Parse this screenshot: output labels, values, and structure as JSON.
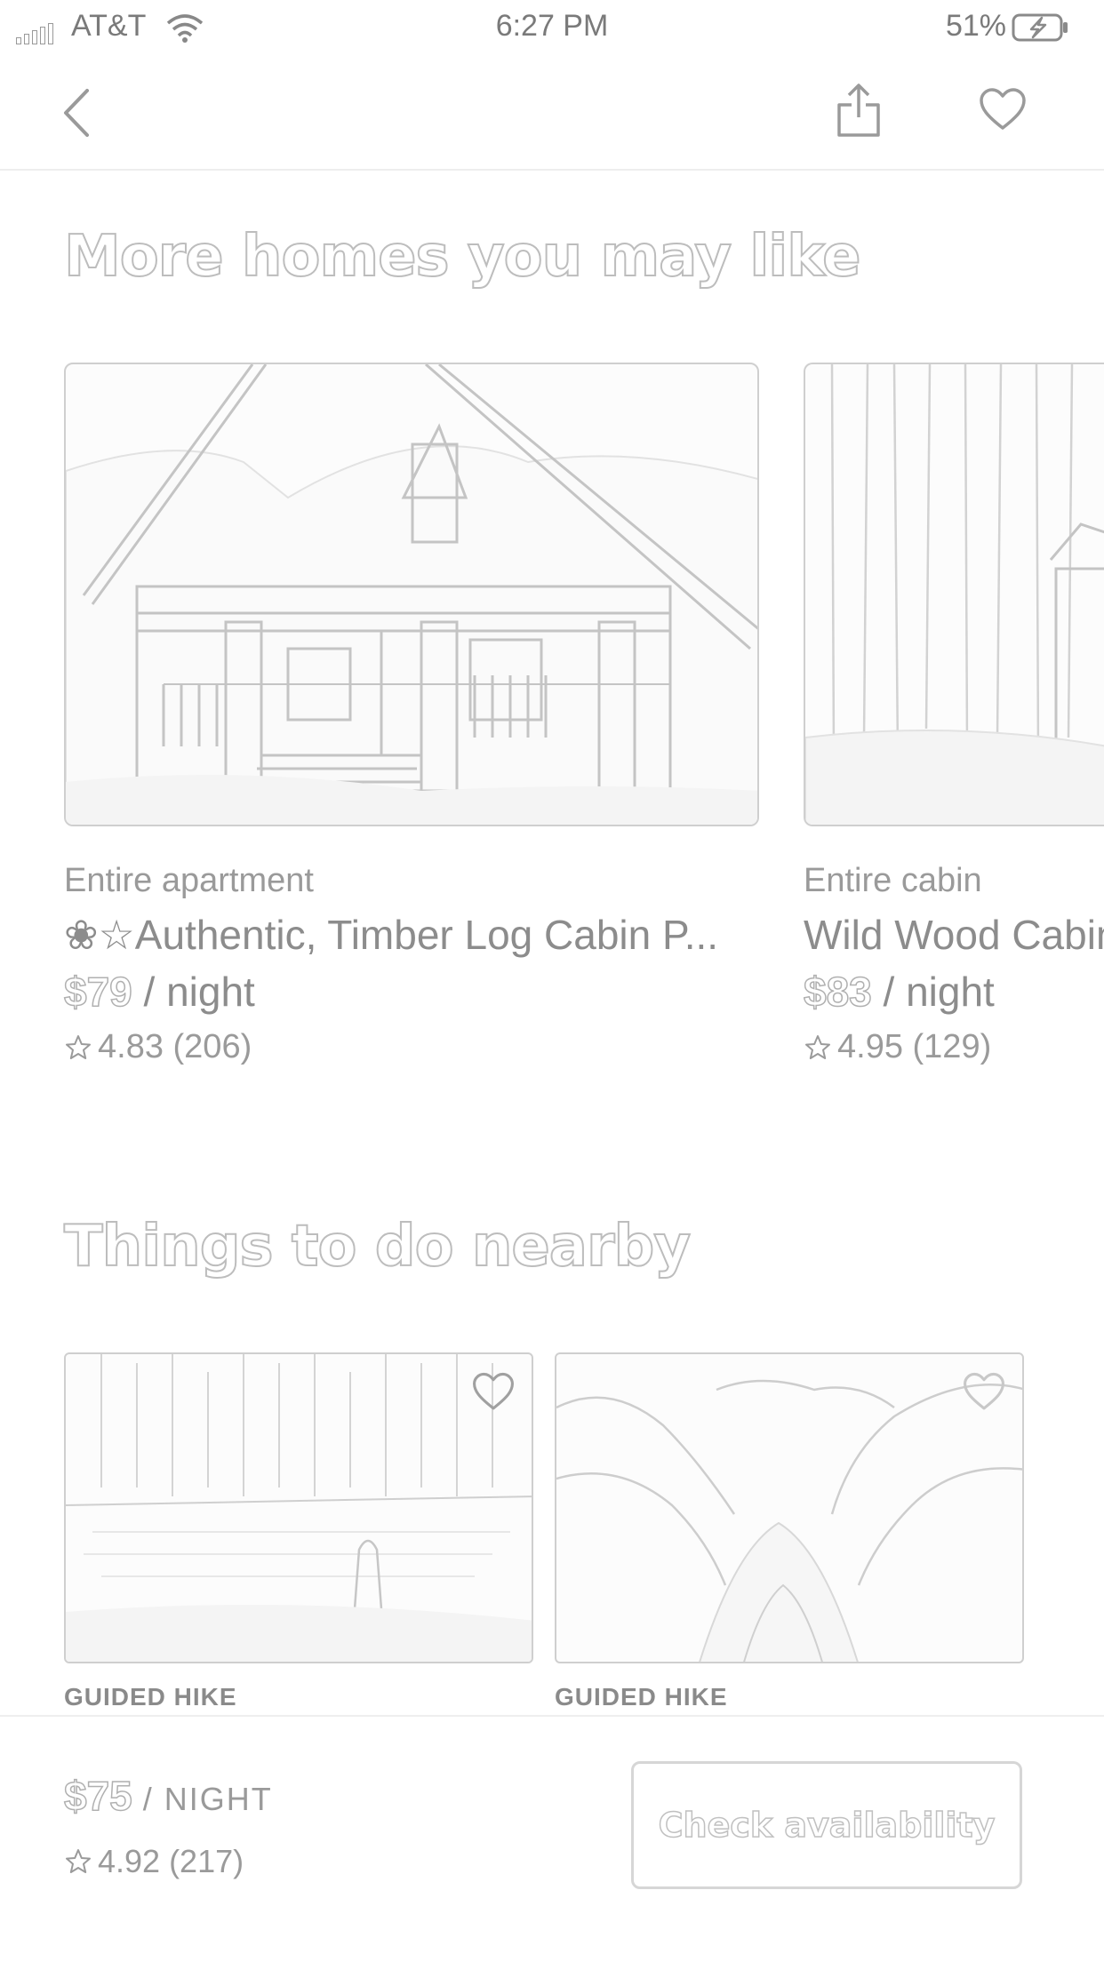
{
  "status_bar": {
    "carrier": "AT&T",
    "time": "6:27 PM",
    "battery": "51%"
  },
  "nav": {
    "back_icon": "chevron-left-icon",
    "share_icon": "share-icon",
    "favorite_icon": "heart-icon"
  },
  "homes_section": {
    "title": "More homes you may like",
    "cards": [
      {
        "type": "Entire apartment",
        "name": "❀☆Authentic, Timber Log Cabin P...",
        "price": "$79",
        "price_unit": " / night",
        "rating": "4.83 (206)",
        "photo": "log-cabin-photo"
      },
      {
        "type": "Entire cabin",
        "name": "Wild Wood Cabin",
        "price": "$83",
        "price_unit": " / night",
        "rating": "4.95 (129)",
        "photo": "forest-cabin-photo"
      }
    ]
  },
  "things_section": {
    "title": "Things to do nearby",
    "cards": [
      {
        "label": "GUIDED HIKE",
        "photo": "lake-forest-photo"
      },
      {
        "label": "GUIDED HIKE",
        "photo": "mountain-valley-photo"
      }
    ]
  },
  "bottom_bar": {
    "price": "$75",
    "price_unit": " / NIGHT",
    "rating": "4.92 (217)",
    "cta_label": "Check availability"
  },
  "colors": {
    "text": "#8a8a8a",
    "outline": "#bdbdbd",
    "border": "#cfcfcf",
    "background": "#ffffff"
  }
}
